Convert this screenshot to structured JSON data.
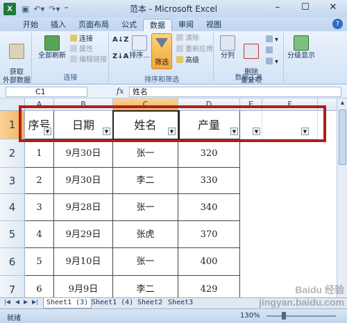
{
  "window": {
    "title": "范本 - Microsoft Excel"
  },
  "ribbon_tabs": [
    "开始",
    "插入",
    "页面布局",
    "公式",
    "数据",
    "审阅",
    "视图"
  ],
  "active_tab": "数据",
  "ribbon": {
    "get_external": "获取\n外部数据",
    "refresh_all": "全部刷新",
    "connections": "连接",
    "properties": "属性",
    "edit_links": "编辑链接",
    "group_connections": "连接",
    "sort": "排序...",
    "filter": "筛选",
    "clear": "清除",
    "reapply": "重新应用",
    "advanced": "高级",
    "group_sort_filter": "排序和筛选",
    "split": "分列",
    "remove_dup": "删除\n重复项",
    "group_data_tools": "数据工具",
    "outline": "分级显示"
  },
  "formula_bar": {
    "name_box": "C1",
    "fx": "fx",
    "content": "姓名"
  },
  "grid": {
    "columns": [
      "A",
      "B",
      "C",
      "D",
      "E",
      "F"
    ],
    "rows": [
      "1",
      "2",
      "3",
      "4",
      "5",
      "6",
      "7"
    ],
    "headers": [
      "序号",
      "日期",
      "姓名",
      "产量"
    ],
    "data": [
      [
        "1",
        "9月30日",
        "张一",
        "320"
      ],
      [
        "2",
        "9月30日",
        "李二",
        "330"
      ],
      [
        "3",
        "9月28日",
        "张一",
        "340"
      ],
      [
        "4",
        "9月29日",
        "张虎",
        "370"
      ],
      [
        "5",
        "9月10日",
        "张一",
        "400"
      ],
      [
        "6",
        "9月9日",
        "李二",
        "429"
      ]
    ]
  },
  "sheets": [
    "Sheet1 (3)",
    "Sheet1 (4)",
    "Sheet2",
    "Sheet3"
  ],
  "active_sheet": "Sheet1 (3)",
  "status": {
    "ready": "就绪",
    "zoom": "130%"
  },
  "watermark": "Baidu 经验\njingyan.baidu.com",
  "colors": {
    "highlight_box": "#b31d16",
    "selected_header": "#f0b45d",
    "ribbon_bg": "#dbe8f7"
  }
}
